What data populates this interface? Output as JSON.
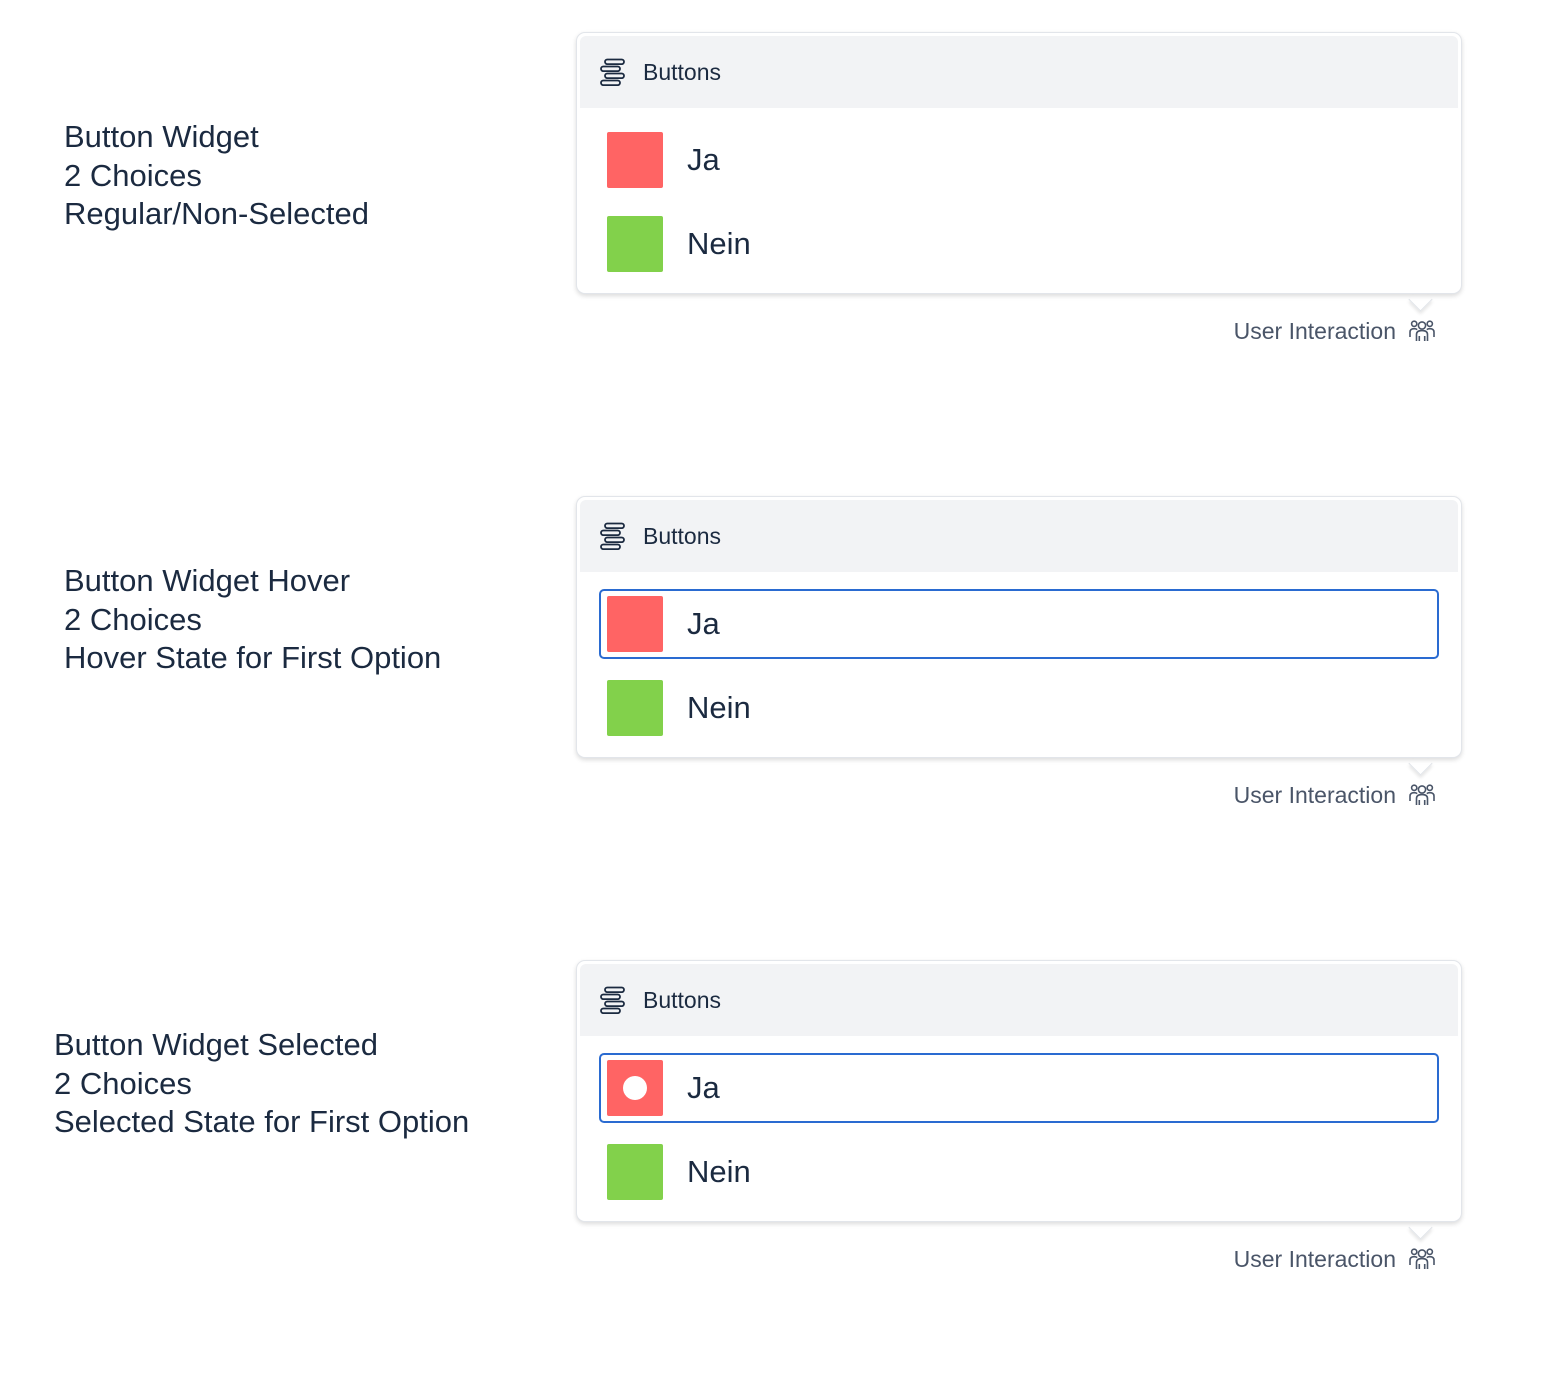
{
  "colors": {
    "text": "#1b2a40",
    "header_bg": "#f2f3f5",
    "highlight_border": "#2a6bd1",
    "option_red": "#ff6464",
    "option_green": "#82d14b"
  },
  "sections": [
    {
      "description": [
        "Button Widget",
        "2 Choices",
        "Regular/Non-Selected"
      ],
      "widget": {
        "header_icon": "list-lines-icon",
        "title": "Buttons",
        "options": [
          {
            "label": "Ja",
            "color": "#ff6464",
            "state": "regular"
          },
          {
            "label": "Nein",
            "color": "#82d14b",
            "state": "regular"
          }
        ],
        "footer_label": "User Interaction",
        "footer_icon": "users-icon"
      }
    },
    {
      "description": [
        "Button Widget Hover",
        "2 Choices",
        "Hover State for First Option"
      ],
      "widget": {
        "header_icon": "list-lines-icon",
        "title": "Buttons",
        "options": [
          {
            "label": "Ja",
            "color": "#ff6464",
            "state": "hover"
          },
          {
            "label": "Nein",
            "color": "#82d14b",
            "state": "regular"
          }
        ],
        "footer_label": "User Interaction",
        "footer_icon": "users-icon"
      }
    },
    {
      "description": [
        "Button Widget Selected",
        "2 Choices",
        "Selected State for First Option"
      ],
      "widget": {
        "header_icon": "list-lines-icon",
        "title": "Buttons",
        "options": [
          {
            "label": "Ja",
            "color": "#ff6464",
            "state": "selected"
          },
          {
            "label": "Nein",
            "color": "#82d14b",
            "state": "regular"
          }
        ],
        "footer_label": "User Interaction",
        "footer_icon": "users-icon"
      }
    }
  ]
}
